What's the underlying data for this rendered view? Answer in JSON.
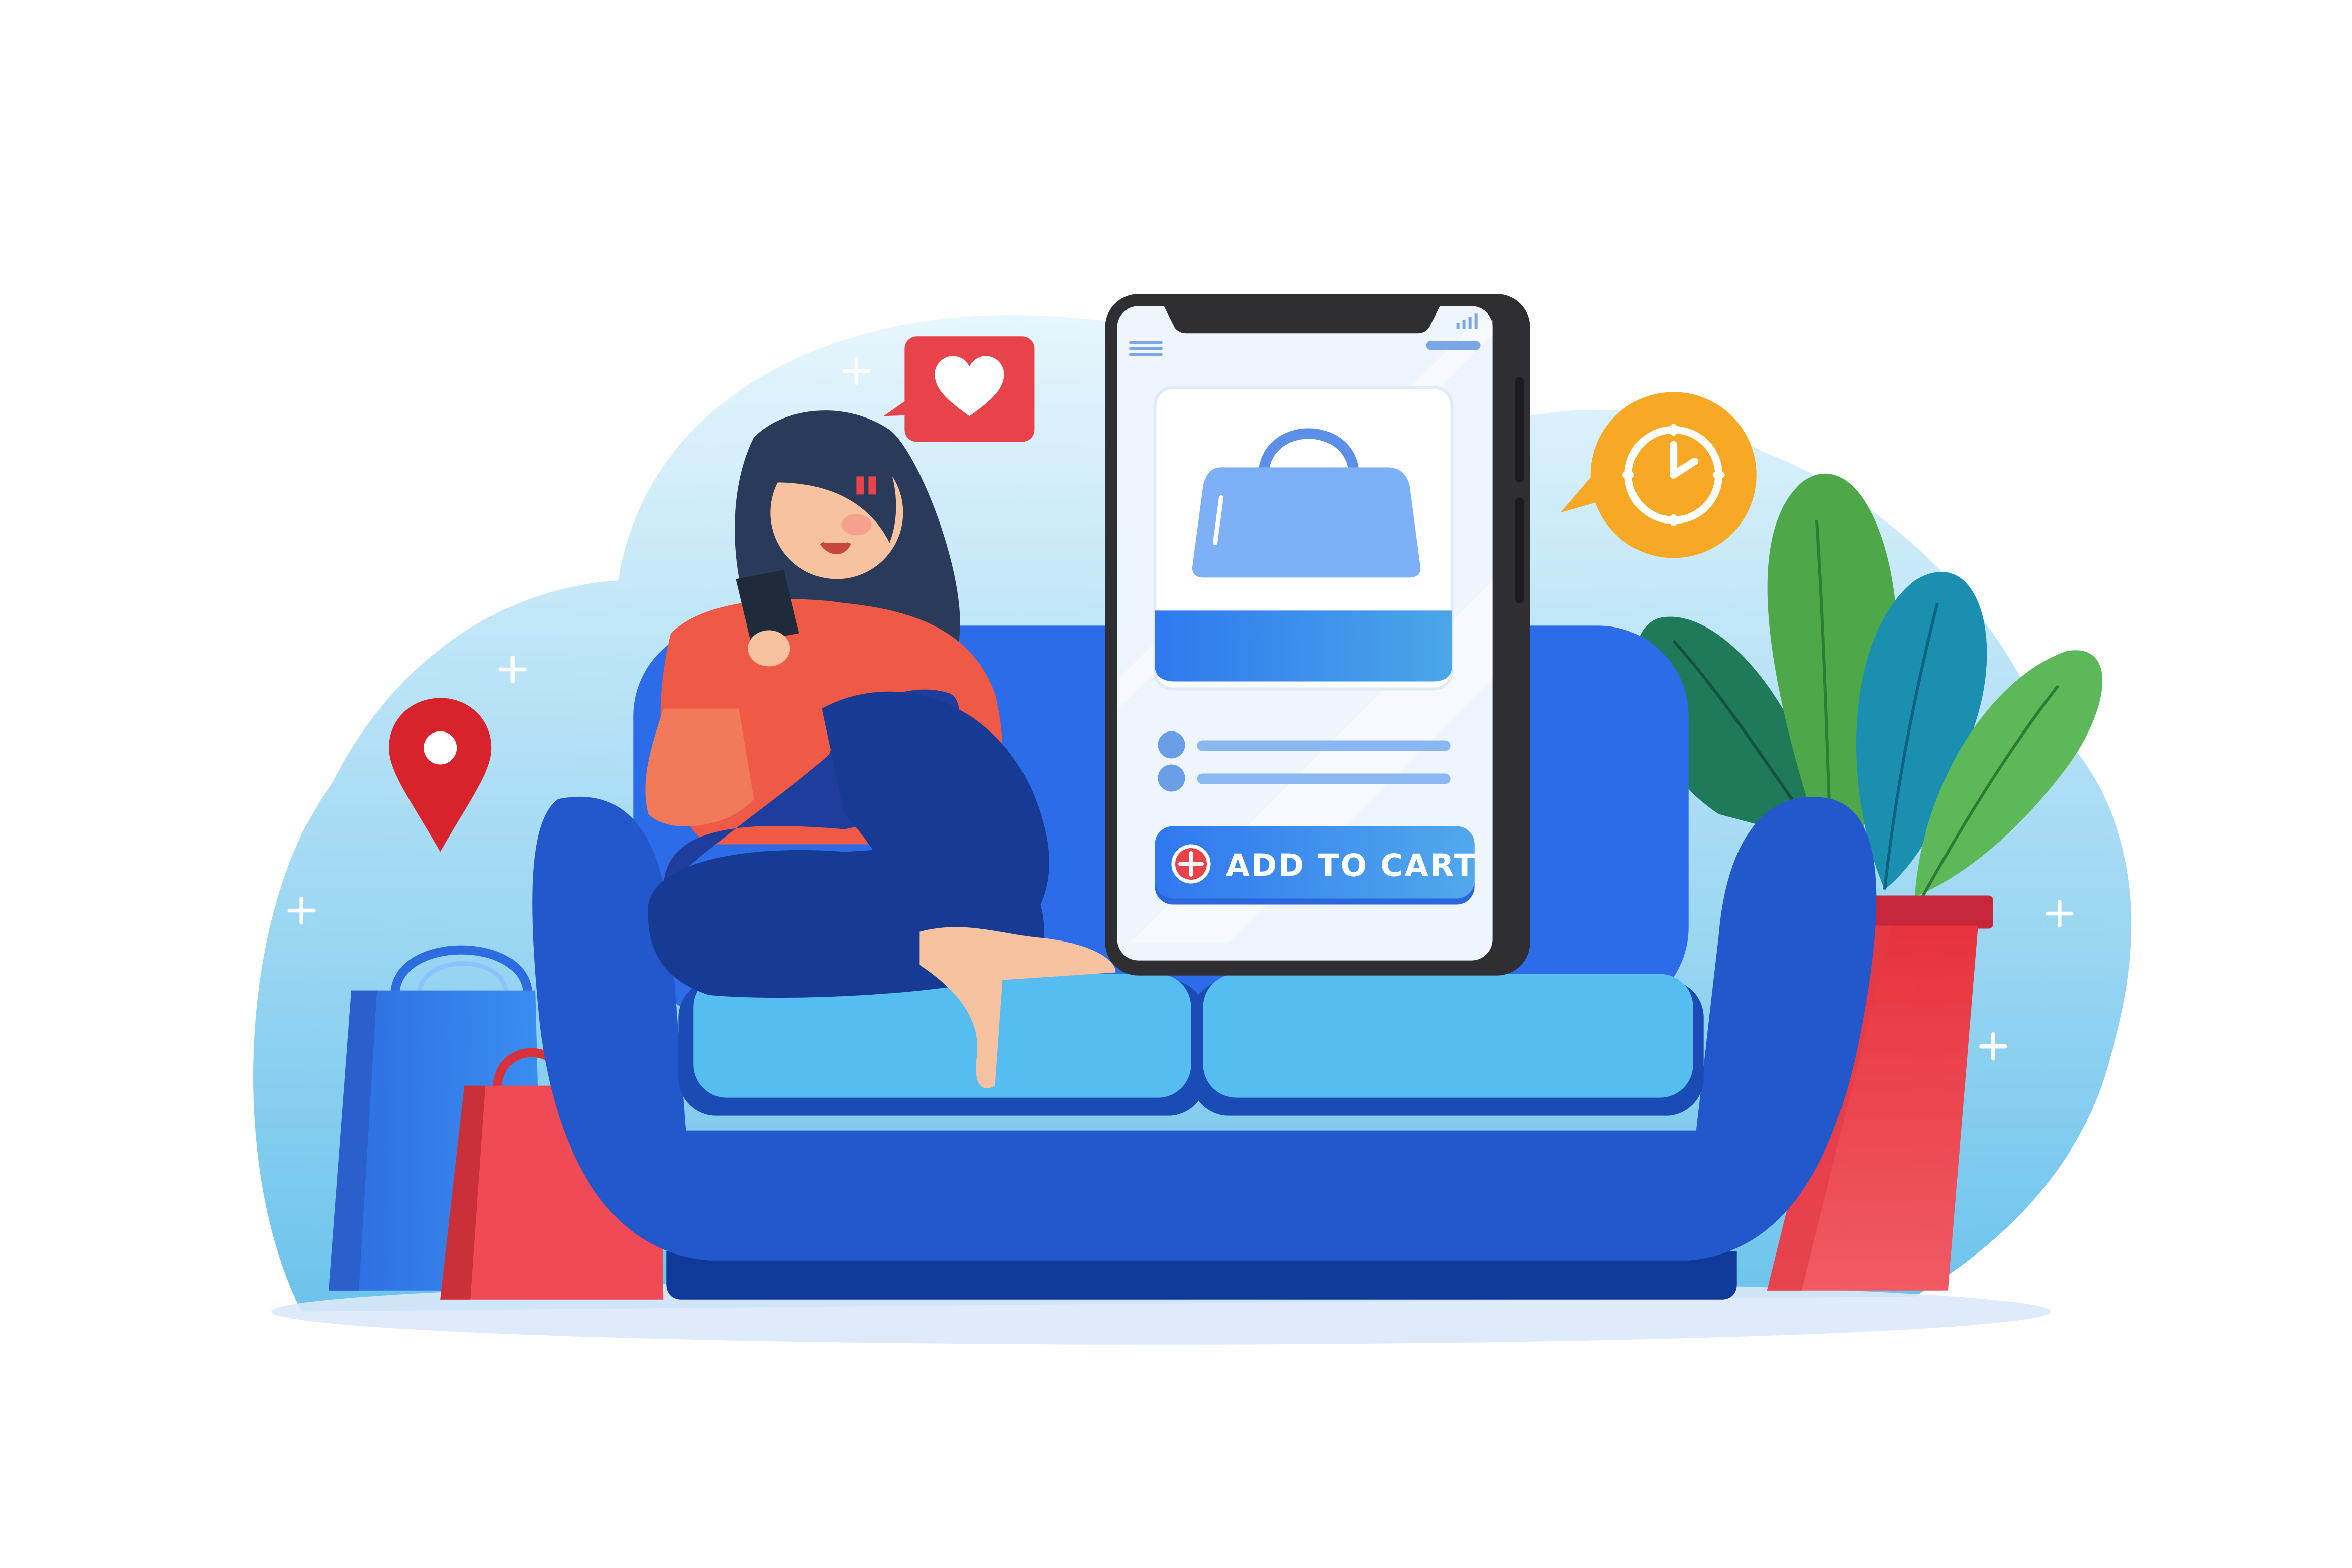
{
  "phone": {
    "add_to_cart_label": "ADD TO CART"
  },
  "icons": {
    "heart_bubble": "heart-icon",
    "clock_bubble": "clock-icon",
    "location_pin": "location-pin-icon",
    "plus_button": "plus-icon",
    "menu": "hamburger-menu-icon",
    "signal": "signal-bars-icon",
    "product": "shopping-bag-icon"
  },
  "colors": {
    "primary_blue": "#3b7be8",
    "sofa_blue": "#2255c4",
    "accent_red": "#e8434b",
    "accent_orange": "#f7a824",
    "background_blob": "#8fd0ef",
    "plant_green": "#4ea84a"
  }
}
